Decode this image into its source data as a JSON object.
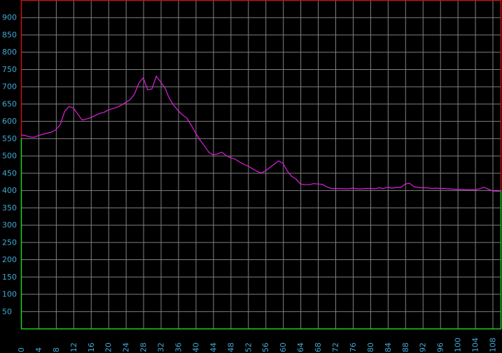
{
  "colors": {
    "background": "#000000",
    "grid": "#808080",
    "series": "#e020e0",
    "axis_labels": "#3fa9d6",
    "frame_upper": "#d01010",
    "frame_lower": "#20d020"
  },
  "chart_data": {
    "type": "line",
    "title": "",
    "xlabel": "",
    "ylabel": "",
    "xlim": [
      0,
      110
    ],
    "ylim": [
      0,
      950
    ],
    "x_ticks": [
      0,
      4,
      8,
      12,
      16,
      20,
      24,
      28,
      32,
      36,
      40,
      44,
      48,
      52,
      56,
      60,
      64,
      68,
      72,
      76,
      80,
      84,
      88,
      92,
      96,
      100,
      104,
      108
    ],
    "y_ticks": [
      50,
      100,
      150,
      200,
      250,
      300,
      350,
      400,
      450,
      500,
      550,
      600,
      650,
      700,
      750,
      800,
      850,
      900
    ],
    "grid": true,
    "legend": "none",
    "series": [
      {
        "x": [
          0,
          1,
          2,
          3,
          4,
          5,
          6,
          7,
          8,
          9,
          10,
          11,
          12,
          13,
          14,
          15,
          16,
          17,
          18,
          19,
          20,
          21,
          22,
          23,
          24,
          25,
          26,
          27,
          28,
          29,
          30,
          31,
          32,
          33,
          34,
          35,
          36,
          37,
          38,
          39,
          40,
          41,
          42,
          43,
          44,
          45,
          46,
          47,
          48,
          49,
          50,
          51,
          52,
          53,
          54,
          55,
          56,
          57,
          58,
          59,
          60,
          61,
          62,
          63,
          64,
          65,
          66,
          67,
          68,
          69,
          70,
          71,
          72,
          73,
          74,
          75,
          76,
          77,
          78,
          79,
          80,
          81,
          82,
          83,
          84,
          85,
          86,
          87,
          88,
          89,
          90,
          91,
          92,
          93,
          94,
          95,
          96,
          97,
          98,
          99,
          100,
          101,
          102,
          103,
          104,
          105,
          106,
          107,
          108,
          109,
          110
        ],
        "values": [
          560,
          558,
          554,
          553,
          558,
          562,
          565,
          568,
          575,
          590,
          628,
          642,
          638,
          620,
          603,
          606,
          610,
          616,
          622,
          625,
          632,
          636,
          640,
          646,
          654,
          662,
          678,
          710,
          725,
          690,
          693,
          730,
          712,
          695,
          665,
          645,
          630,
          618,
          608,
          588,
          565,
          545,
          528,
          510,
          502,
          505,
          510,
          500,
          494,
          490,
          482,
          475,
          470,
          462,
          455,
          450,
          456,
          466,
          475,
          485,
          478,
          455,
          440,
          432,
          418,
          416,
          416,
          419,
          418,
          417,
          410,
          405,
          405,
          405,
          404,
          404,
          406,
          404,
          404,
          405,
          405,
          404,
          407,
          405,
          408,
          406,
          408,
          408,
          418,
          420,
          410,
          408,
          407,
          407,
          405,
          406,
          405,
          405,
          404,
          403,
          402,
          402,
          401,
          401,
          401,
          404,
          408,
          403,
          398,
          397,
          398
        ]
      }
    ]
  }
}
